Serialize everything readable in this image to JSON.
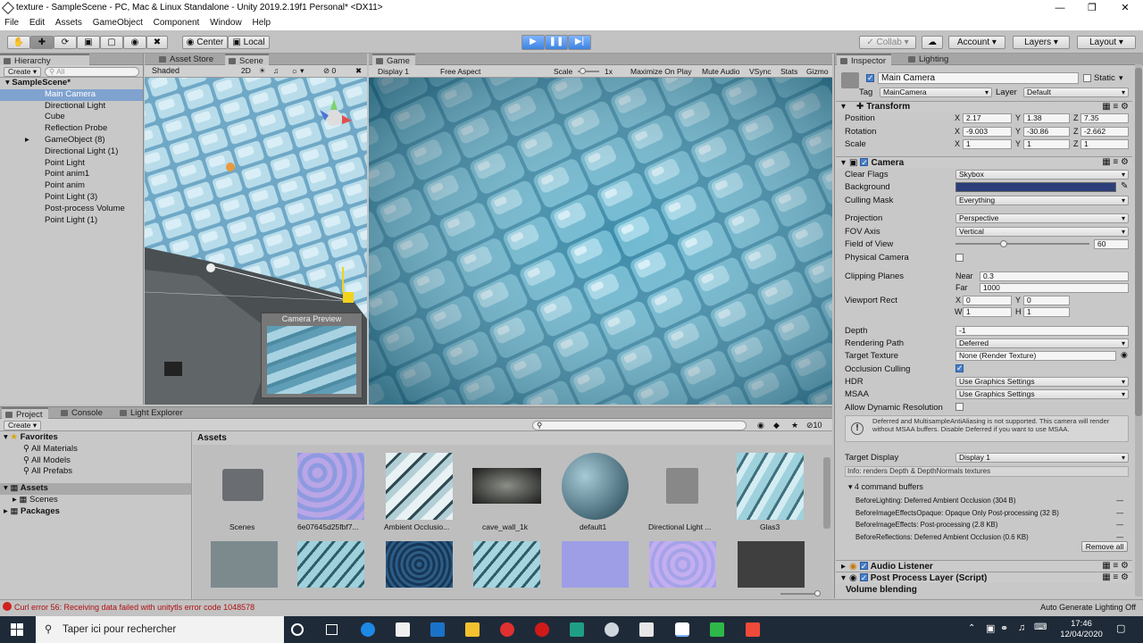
{
  "window": {
    "title": "texture - SampleScene - PC, Mac & Linux Standalone - Unity 2019.2.19f1 Personal* <DX11>"
  },
  "menu": [
    "File",
    "Edit",
    "Assets",
    "GameObject",
    "Component",
    "Window",
    "Help"
  ],
  "toolbar": {
    "center_label": "Center",
    "local_label": "Local",
    "collab_label": "Collab",
    "account_label": "Account",
    "layers_label": "Layers",
    "layout_label": "Layout"
  },
  "hierarchy": {
    "tab": "Hierarchy",
    "create": "Create",
    "search_placeholder": "All",
    "scene": "SampleScene*",
    "items": [
      "Main Camera",
      "Directional Light",
      "Cube",
      "Reflection Probe",
      "GameObject (8)",
      "Directional Light (1)",
      "Point Light",
      "Point anim1",
      "Point anim",
      "Point Light (3)",
      "Post-process Volume",
      "Point Light (1)"
    ]
  },
  "scene": {
    "tabs": [
      "Asset Store",
      "Scene"
    ],
    "shading": "Shaded",
    "mode_2d": "2D",
    "gizmo_count": "0",
    "camera_preview": "Camera Preview"
  },
  "game": {
    "tab": "Game",
    "display": "Display 1",
    "aspect": "Free Aspect",
    "scale_label": "Scale",
    "scale_value": "1x",
    "buttons": [
      "Maximize On Play",
      "Mute Audio",
      "VSync",
      "Stats",
      "Gizmo"
    ]
  },
  "inspector": {
    "tabs": [
      "Inspector",
      "Lighting"
    ],
    "object_name": "Main Camera",
    "static_label": "Static",
    "tag_label": "Tag",
    "tag_value": "MainCamera",
    "layer_label": "Layer",
    "layer_value": "Default",
    "transform": {
      "title": "Transform",
      "position_label": "Position",
      "rotation_label": "Rotation",
      "scale_label": "Scale",
      "position": {
        "x": "2.17",
        "y": "1.38",
        "z": "7.35"
      },
      "rotation": {
        "x": "-9.003",
        "y": "-30.86",
        "z": "-2.662"
      },
      "scale": {
        "x": "1",
        "y": "1",
        "z": "1"
      }
    },
    "camera": {
      "title": "Camera",
      "clear_flags_label": "Clear Flags",
      "clear_flags": "Skybox",
      "background_label": "Background",
      "background_color": "#2c3f7a",
      "culling_mask_label": "Culling Mask",
      "culling_mask": "Everything",
      "projection_label": "Projection",
      "projection": "Perspective",
      "fov_axis_label": "FOV Axis",
      "fov_axis": "Vertical",
      "fov_label": "Field of View",
      "fov": "60",
      "fov_fraction": 0.36,
      "physical_label": "Physical Camera",
      "clipping_label": "Clipping Planes",
      "near_label": "Near",
      "near": "0.3",
      "far_label": "Far",
      "far": "1000",
      "viewport_label": "Viewport Rect",
      "vx": "0",
      "vy": "0",
      "vw": "1",
      "vh": "1",
      "depth_label": "Depth",
      "depth": "-1",
      "rendering_path_label": "Rendering Path",
      "rendering_path": "Deferred",
      "target_texture_label": "Target Texture",
      "target_texture": "None (Render Texture)",
      "occlusion_label": "Occlusion Culling",
      "hdr_label": "HDR",
      "hdr": "Use Graphics Settings",
      "msaa_label": "MSAA",
      "msaa": "Use Graphics Settings",
      "dynres_label": "Allow Dynamic Resolution",
      "warning": "Deferred and MultisampleAntiAliasing is not supported. This camera will render without MSAA buffers. Disable Deferred if you want to use MSAA.",
      "target_display_label": "Target Display",
      "target_display": "Display 1",
      "info": "Info: renders Depth & DepthNormals textures",
      "cmd_header": "4 command buffers",
      "cmds": [
        "BeforeLighting: Deferred Ambient Occlusion (304 B)",
        "BeforeImageEffectsOpaque: Opaque Only Post-processing (32 B)",
        "BeforeImageEffects: Post-processing (2.8 KB)",
        "BeforeReflections: Deferred Ambient Occlusion (0.6 KB)"
      ],
      "remove_all": "Remove all"
    },
    "audio_listener": "Audio Listener",
    "post_process": "Post Process Layer (Script)",
    "volume_blending": "Volume blending"
  },
  "project": {
    "tabs": [
      "Project",
      "Console",
      "Light Explorer"
    ],
    "create": "Create",
    "favorites": "Favorites",
    "fav_items": [
      "All Materials",
      "All Models",
      "All Prefabs"
    ],
    "assets_root": "Assets",
    "asset_children": [
      "Scenes"
    ],
    "packages": "Packages",
    "breadcrumb": "Assets",
    "count": "10",
    "assets": [
      "Scenes",
      "6e07645d25fbf7...",
      "Ambient Occlusio...",
      "cave_wall_1k",
      "default1",
      "Directional Light ...",
      "Glas3"
    ]
  },
  "status": {
    "error": "Curl error 56: Receiving data failed with unitytls error code 1048578",
    "right": "Auto Generate Lighting Off"
  },
  "taskbar": {
    "search_placeholder": "Taper ici pour rechercher",
    "time": "17:46",
    "date": "12/04/2020"
  }
}
